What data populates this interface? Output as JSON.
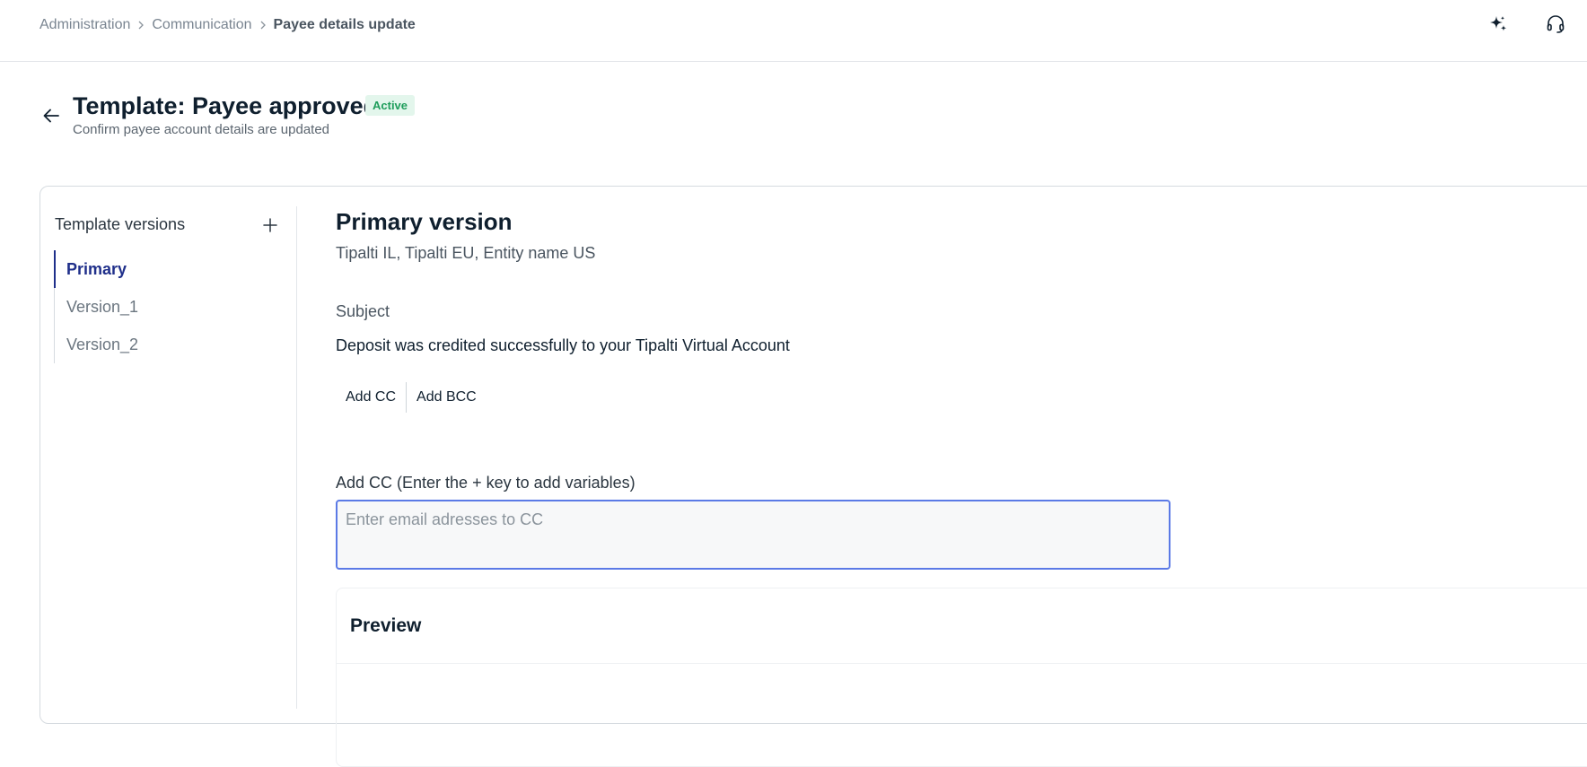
{
  "breadcrumb": {
    "items": [
      "Administration",
      "Communication"
    ],
    "current": "Payee details update"
  },
  "header": {
    "title": "Template: Payee approved",
    "status": "Active",
    "subtitle": "Confirm payee account details are updated"
  },
  "sidebar": {
    "title": "Template versions",
    "versions": [
      "Primary",
      "Version_1",
      "Version_2"
    ],
    "active_version": "Primary"
  },
  "main": {
    "title": "Primary version",
    "entities": "Tipalti IL, Tipalti EU, Entity name US",
    "subject_label": "Subject",
    "subject_value": "Deposit was credited successfully to your Tipalti Virtual Account",
    "add_cc_label": "Add CC",
    "add_bcc_label": "Add BCC",
    "cc_field_label": "Add CC (Enter the + key to add variables)",
    "cc_placeholder": "Enter email adresses to CC",
    "cc_value": "",
    "preview_title": "Preview"
  },
  "icons": {
    "assistant": "sparkle-icon",
    "support": "headset-icon",
    "back": "arrow-left-icon",
    "add": "plus-icon",
    "separator": "chevron-right-icon"
  },
  "colors": {
    "accent": "#1f2f8a",
    "focus_border": "#5b7ae6",
    "status_bg": "#e3f6ec",
    "status_text": "#1f9d5b"
  }
}
